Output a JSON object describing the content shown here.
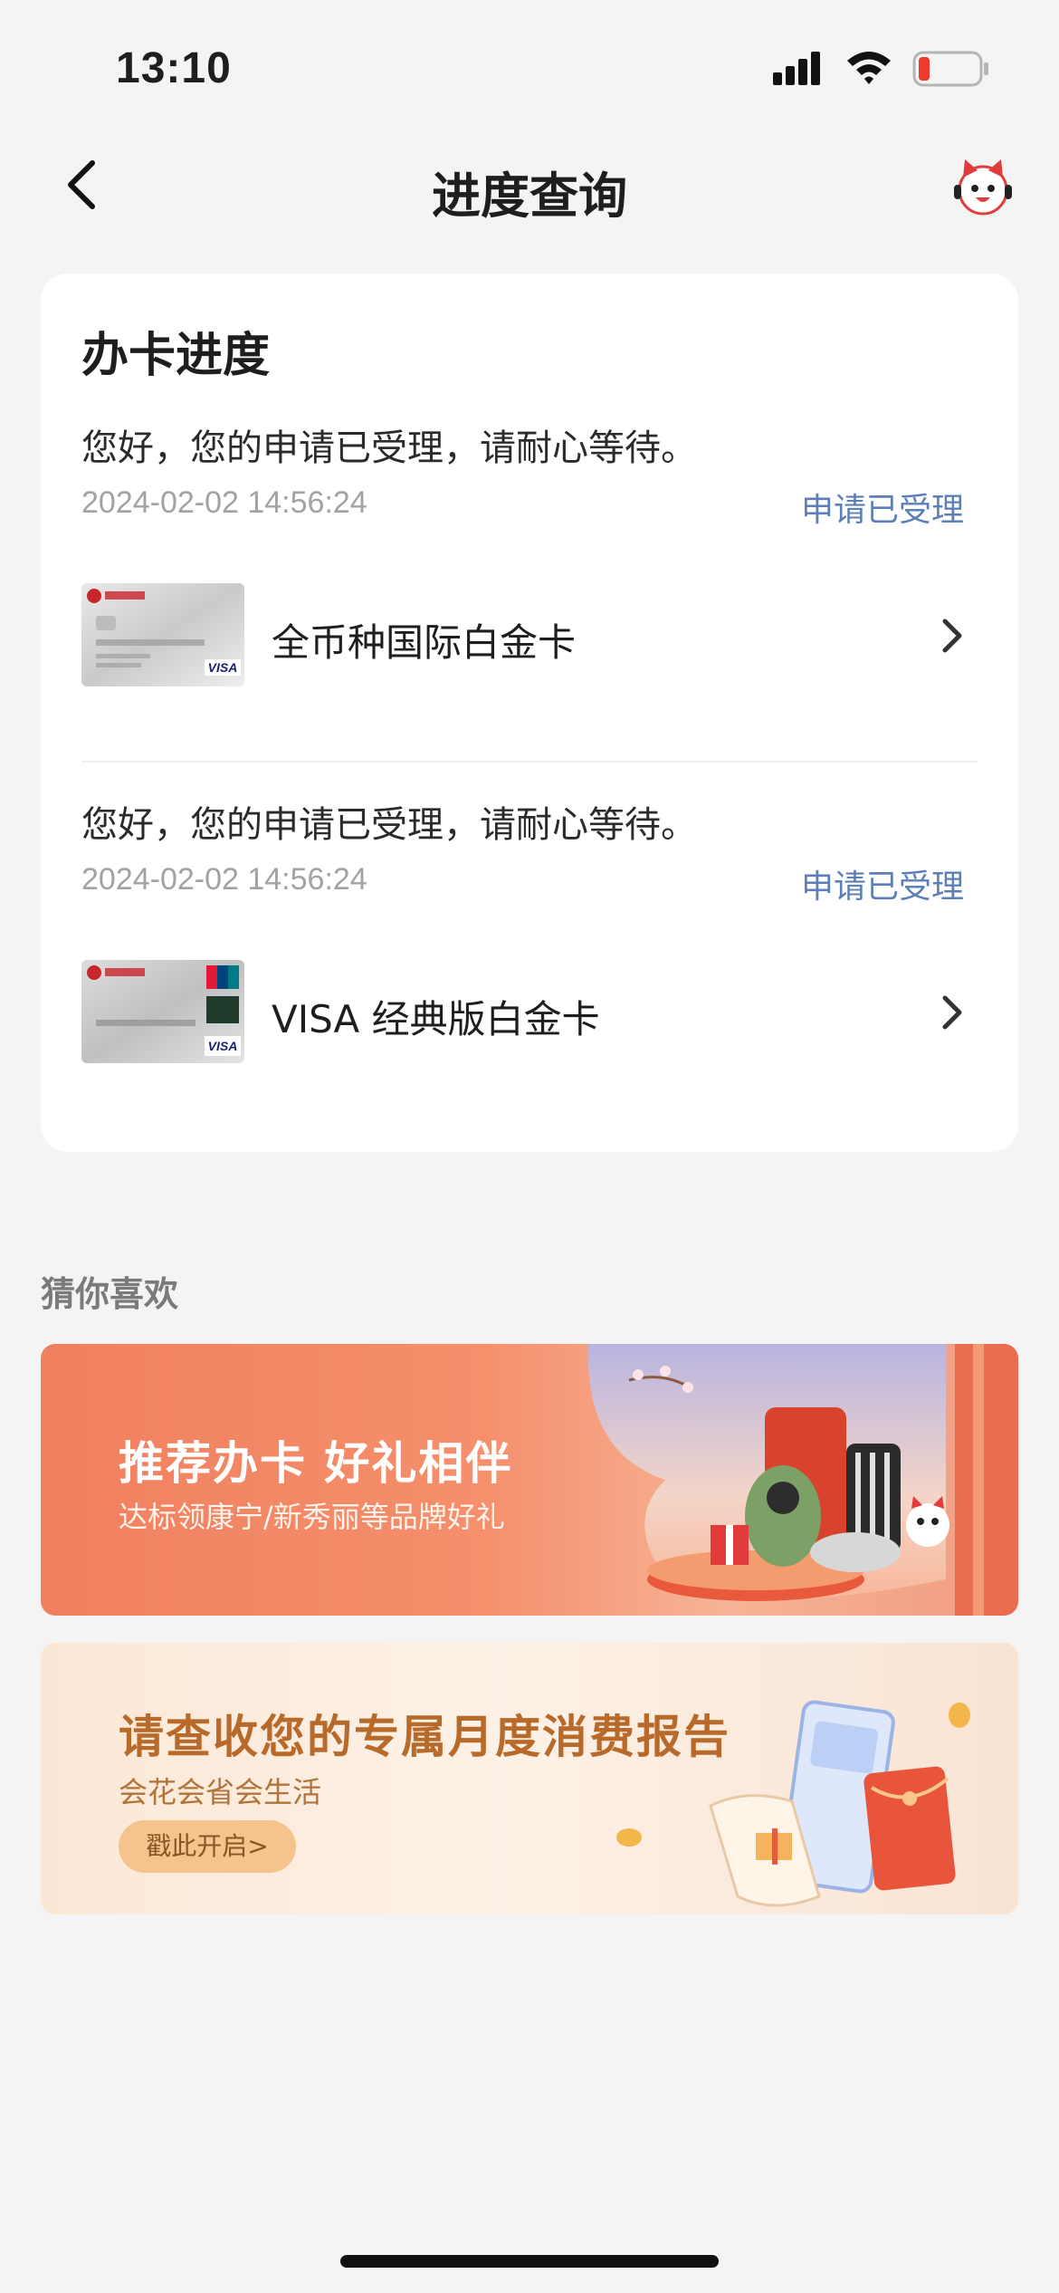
{
  "status_bar": {
    "time": "13:10"
  },
  "nav": {
    "title": "进度查询"
  },
  "progress": {
    "title": "办卡进度",
    "applications": [
      {
        "message": "您好，您的申请已受理，请耐心等待。",
        "time": "2024-02-02 14:56:24",
        "status": "申请已受理",
        "card_name": "全币种国际白金卡"
      },
      {
        "message": "您好，您的申请已受理，请耐心等待。",
        "time": "2024-02-02 14:56:24",
        "status": "申请已受理",
        "card_name": "VISA 经典版白金卡"
      }
    ]
  },
  "recommend": {
    "title": "猜你喜欢",
    "banners": [
      {
        "title": "推荐办卡 好礼相伴",
        "subtitle": "达标领康宁/新秀丽等品牌好礼"
      },
      {
        "title": "请查收您的专属月度消费报告",
        "subtitle": "会花会省会生活",
        "button": "戳此开启>"
      }
    ]
  },
  "colors": {
    "status_blue": "#5d7fb9",
    "background": "#f4f4f5",
    "banner_orange": "#f0805f"
  }
}
